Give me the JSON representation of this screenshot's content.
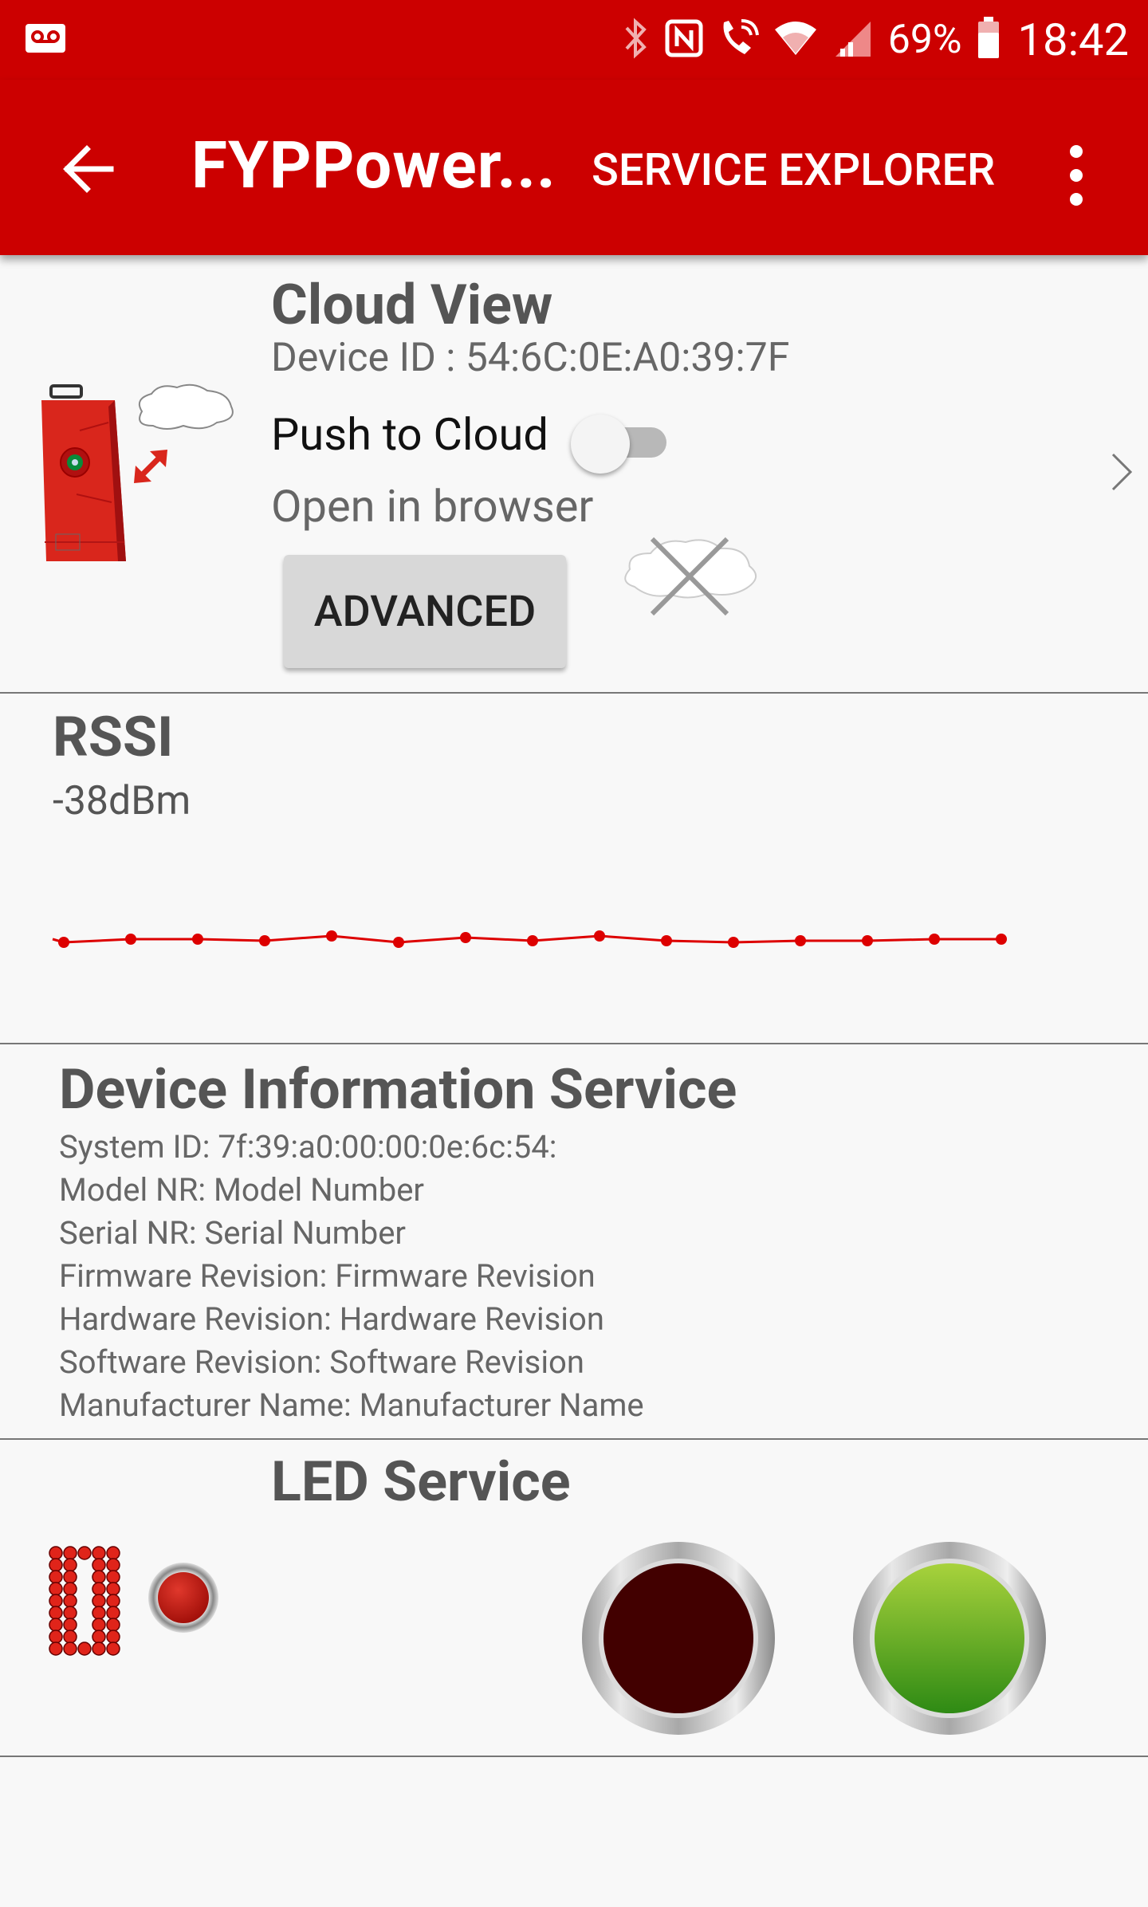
{
  "status_bar": {
    "battery_percent": "69%",
    "time": "18:42",
    "icons": [
      "voicemail-icon",
      "bluetooth-icon",
      "nfc-icon",
      "wifi-call-icon",
      "wifi-icon",
      "signal-icon",
      "battery-icon"
    ]
  },
  "app_bar": {
    "back_icon": "arrow-left-icon",
    "title": "FYPPower...",
    "action_label": "SERVICE EXPLORER",
    "overflow_icon": "more-vert-icon",
    "background_color": "#cc0000"
  },
  "cloud_view": {
    "title": "Cloud View",
    "device_id_label": "Device ID : 54:6C:0E:A0:39:7F",
    "push_to_cloud_label": "Push to Cloud",
    "push_to_cloud_enabled": false,
    "open_in_browser_label": "Open in browser",
    "advanced_button_label": "ADVANCED",
    "cloud_status_icon": "cloud-disconnected-icon"
  },
  "rssi": {
    "title": "RSSI",
    "value": "-38dBm",
    "line_color": "#dd0000"
  },
  "device_information": {
    "title": "Device Information Service",
    "lines": [
      "System ID: 7f:39:a0:00:00:0e:6c:54:",
      "Model NR: Model Number",
      "Serial NR: Serial Number",
      "Firmware Revision: Firmware Revision",
      "Hardware Revision: Hardware Revision",
      "Software Revision: Software Revision",
      "Manufacturer Name: Manufacturer Name"
    ]
  },
  "led_service": {
    "title": "LED Service",
    "red_button_color": "#420000",
    "green_button_color": "#5aaa1e"
  }
}
